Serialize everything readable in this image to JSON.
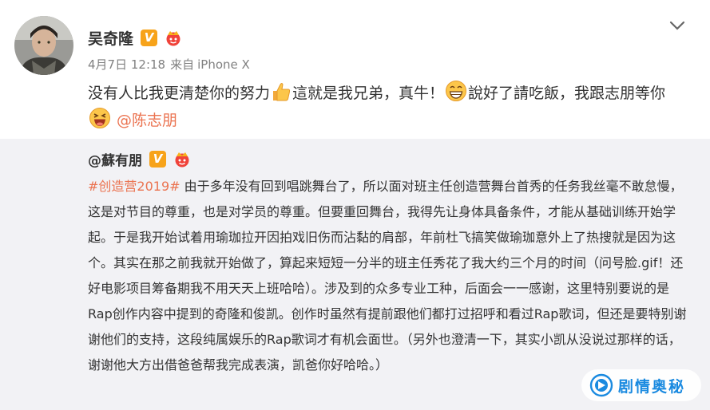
{
  "post": {
    "author": "吴奇隆",
    "verified_badge": "V",
    "time": "4月7日 12:18",
    "source_prefix": "来自",
    "source": "iPhone X",
    "text_1": "没有人比我更清楚你的努力",
    "text_2": "這就是我兄弟，真牛！",
    "text_3": "說好了請吃飯，我跟志朋等你",
    "mention": "@陈志朋"
  },
  "repost": {
    "author": "@蘇有朋",
    "verified_badge": "V",
    "topic": "#创造营2019#",
    "text": " 由于多年没有回到唱跳舞台了，所以面对班主任创造营舞台首秀的任务我丝毫不敢怠慢，这是对节目的尊重，也是对学员的尊重。但要重回舞台，我得先让身体具备条件，才能从基础训练开始学起。于是我开始试着用瑜珈拉开因拍戏旧伤而沾黏的肩部，年前杜飞搞笑做瑜珈意外上了热搜就是因为这个。其实在那之前我就开始做了，算起来短短一分半的班主任秀花了我大约三个月的时间（问号脸.gif！还好电影项目筹备期我不用天天上班哈哈）。涉及到的众多专业工种，后面会一一感谢，这里特别要说的是Rap创作内容中提到的奇隆和俊凯。创作时虽然有提前跟他们都打过招呼和看过Rap歌词，但还是要特别谢谢他们的支持，这段纯属娱乐的Rap歌词才有机会面世。（另外也澄清一下，其实小凯从没说过那样的话，谢谢他大方出借爸爸帮我完成表演，凯爸你好哈哈。）"
  },
  "watermark": {
    "text": "剧情奥秘"
  },
  "icons": [
    "avatar",
    "verified-v-icon",
    "crown-badge-icon",
    "chevron-down-icon",
    "thumbs-up-emoji",
    "grin-emoji",
    "laugh-emoji",
    "watermark-logo-icon"
  ],
  "colors": {
    "accent": "#eb7350",
    "badge": "#f7a31a",
    "repost_bg": "#f2f2f5",
    "meta": "#808080",
    "watermark": "#1a8ae0"
  }
}
